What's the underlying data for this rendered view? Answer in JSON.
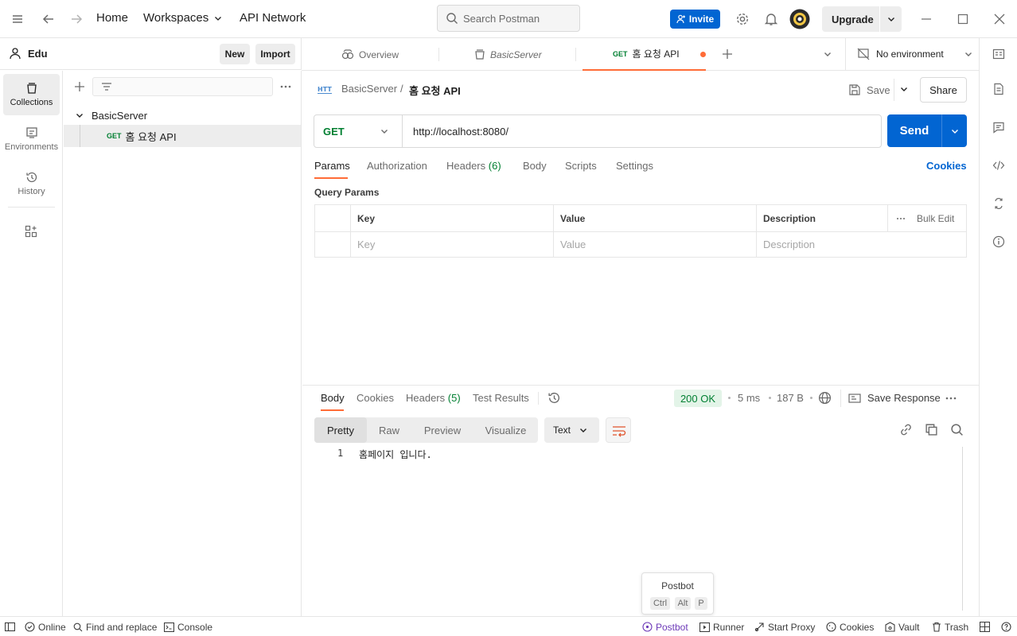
{
  "topbar": {
    "home": "Home",
    "workspaces": "Workspaces",
    "api_network": "API Network",
    "search_placeholder": "Search Postman",
    "invite": "Invite",
    "upgrade": "Upgrade"
  },
  "user": {
    "name": "Edu",
    "new": "New",
    "import": "Import"
  },
  "rail": [
    "Collections",
    "Environments",
    "History"
  ],
  "sidebar": {
    "collection": "BasicServer",
    "request": {
      "method": "GET",
      "name": "홈 요청 API"
    }
  },
  "tabs": {
    "overview": "Overview",
    "basicserver": "BasicServer",
    "active": {
      "method": "GET",
      "name": "홈 요청 API"
    },
    "environment": "No environment"
  },
  "request": {
    "breadcrumb_collection": "BasicServer",
    "breadcrumb_sep": "/",
    "breadcrumb_request": "홈 요청 API",
    "save": "Save",
    "share": "Share",
    "method": "GET",
    "url": "http://localhost:8080/",
    "send": "Send",
    "tabs": [
      "Params",
      "Authorization",
      "Headers",
      "Body",
      "Scripts",
      "Settings"
    ],
    "headers_count": "(6)",
    "cookies": "Cookies",
    "query_params_title": "Query Params",
    "columns": [
      "Key",
      "Value",
      "Description"
    ],
    "bulk_edit": "Bulk Edit",
    "placeholders": [
      "Key",
      "Value",
      "Description"
    ]
  },
  "response": {
    "tabs": [
      "Body",
      "Cookies",
      "Headers",
      "Test Results"
    ],
    "headers_count": "(5)",
    "status": "200 OK",
    "time": "5 ms",
    "size": "187 B",
    "save_response": "Save Response",
    "formats": [
      "Pretty",
      "Raw",
      "Preview",
      "Visualize"
    ],
    "type": "Text",
    "line_number": "1",
    "line_text": "홈페이지 입니다."
  },
  "postbot_tip": {
    "title": "Postbot",
    "keys": [
      "Ctrl",
      "Alt",
      "P"
    ]
  },
  "statusbar": {
    "online": "Online",
    "find_replace": "Find and replace",
    "console": "Console",
    "postbot": "Postbot",
    "runner": "Runner",
    "start_proxy": "Start Proxy",
    "cookies": "Cookies",
    "vault": "Vault",
    "trash": "Trash"
  },
  "colors": {
    "accent": "#0265d2",
    "get": "#007f31",
    "active_tab": "#ff6c37",
    "status_ok": "#007f31"
  }
}
